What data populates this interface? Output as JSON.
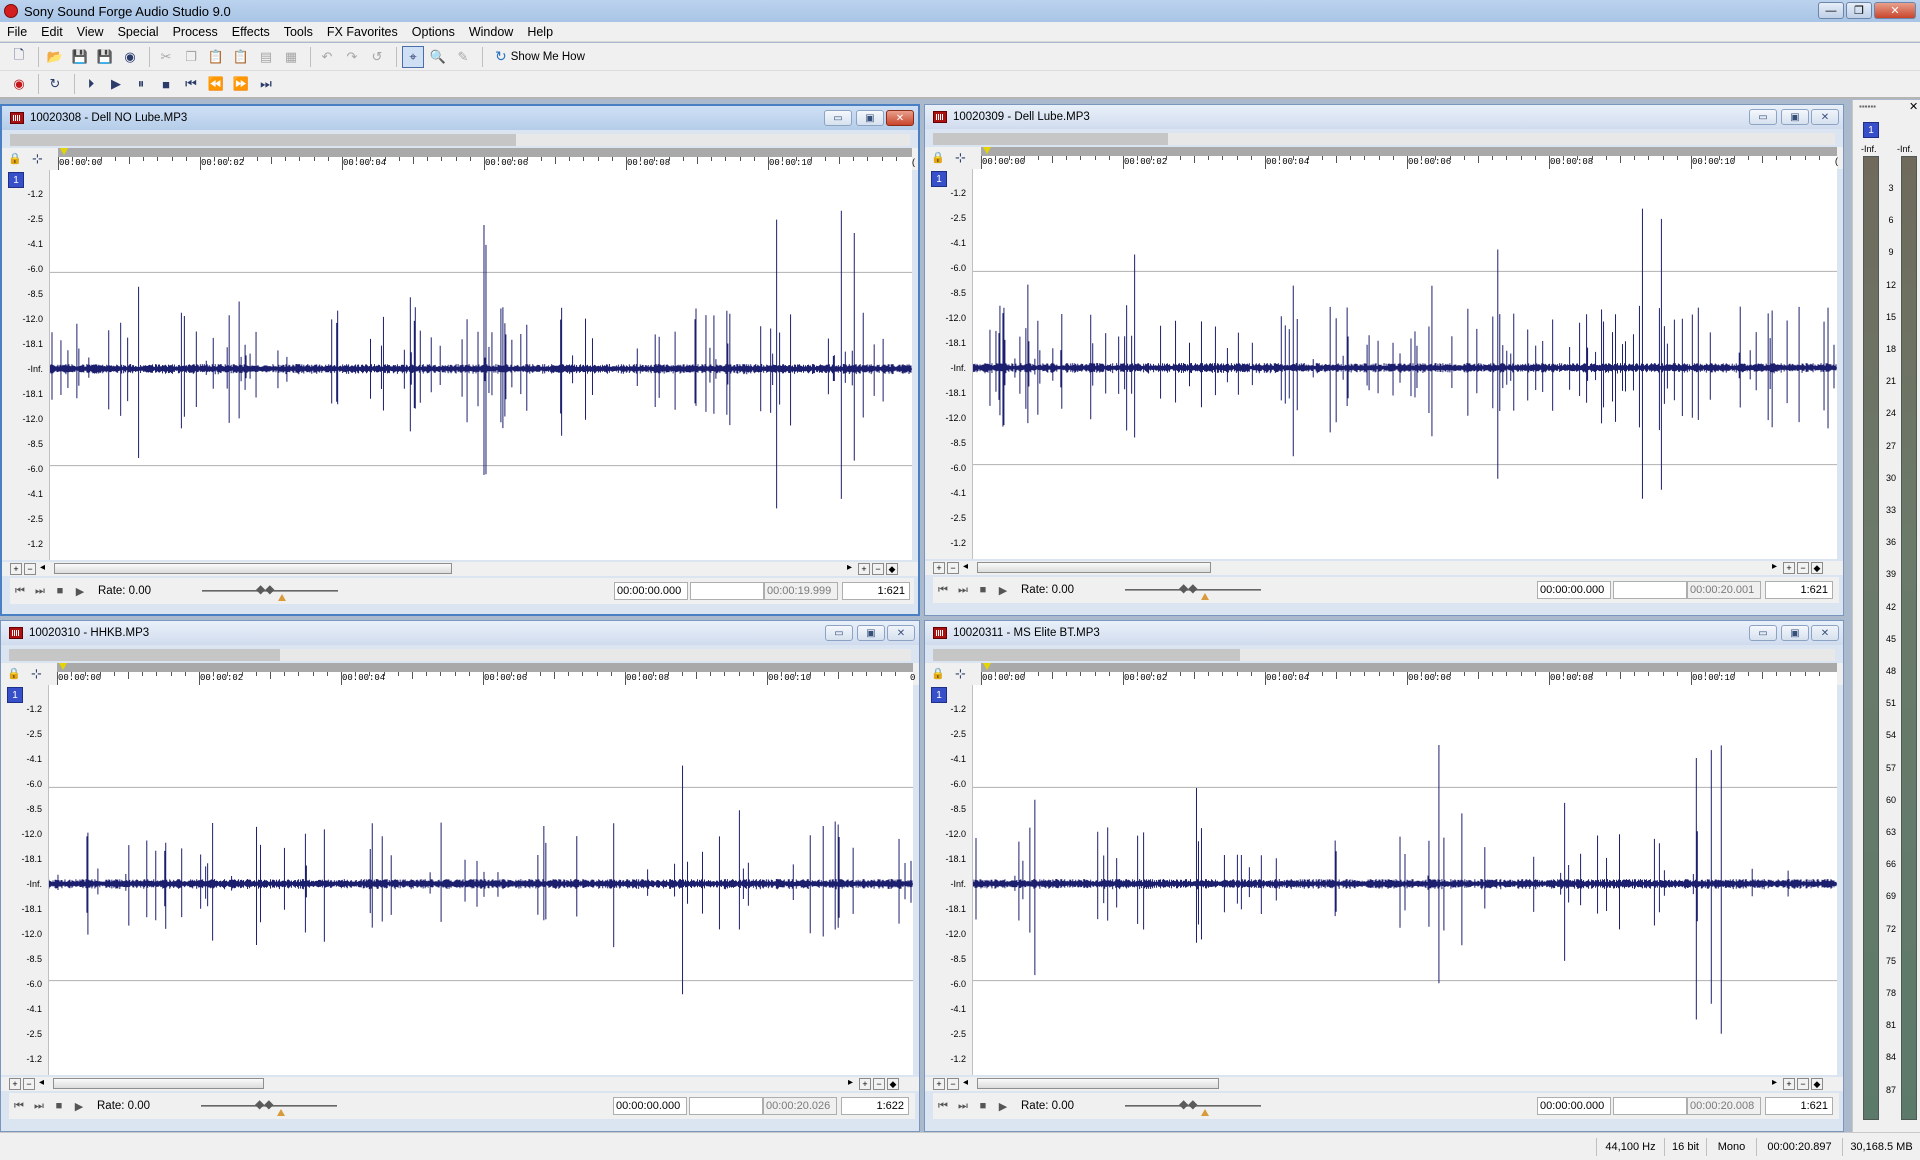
{
  "app": {
    "title": "Sony Sound Forge Audio Studio 9.0",
    "window_controls": [
      "—",
      "❐",
      "✕"
    ]
  },
  "menu": [
    "File",
    "Edit",
    "View",
    "Special",
    "Process",
    "Effects",
    "Tools",
    "FX Favorites",
    "Options",
    "Window",
    "Help"
  ],
  "toolbar": {
    "show_me_how": "Show Me How"
  },
  "ruler_labels": [
    "00:00:00",
    "00:00:02",
    "00:00:04",
    "00:00:06",
    "00:00:08",
    "00:00:10"
  ],
  "db_labels": [
    "-1.2",
    "-2.5",
    "-4.1",
    "-6.0",
    "-8.5",
    "-12.0",
    "-18.1",
    "-Inf.",
    "-18.1",
    "-12.0",
    "-8.5",
    "-6.0",
    "-4.1",
    "-2.5",
    "-1.2"
  ],
  "windows": [
    {
      "title": "10020308 - Dell NO Lube.MP3",
      "channel": "1",
      "rate_label": "Rate: 0.00",
      "selection_start": "00:00:00.000",
      "selection_length": "",
      "length": "00:00:19.999",
      "zoom": "1:621",
      "active": true,
      "overview_fraction": 0.56,
      "scroll_fraction": 0.51,
      "ruler_cutoff": "("
    },
    {
      "title": "10020309 - Dell Lube.MP3",
      "channel": "1",
      "rate_label": "Rate: 0.00",
      "selection_start": "00:00:00.000",
      "selection_length": "",
      "length": "00:00:20.001",
      "zoom": "1:621",
      "active": false,
      "overview_fraction": 0.26,
      "scroll_fraction": 0.3,
      "ruler_cutoff": "("
    },
    {
      "title": "10020310 - HHKB.MP3",
      "channel": "1",
      "rate_label": "Rate: 0.00",
      "selection_start": "00:00:00.000",
      "selection_length": "",
      "length": "00:00:20.026",
      "zoom": "1:622",
      "active": false,
      "overview_fraction": 0.3,
      "scroll_fraction": 0.27,
      "ruler_cutoff": "0"
    },
    {
      "title": "10020311 - MS Elite BT.MP3",
      "channel": "1",
      "rate_label": "Rate: 0.00",
      "selection_start": "00:00:00.000",
      "selection_length": "",
      "length": "00:00:20.008",
      "zoom": "1:621",
      "active": false,
      "overview_fraction": 0.34,
      "scroll_fraction": 0.31,
      "ruler_cutoff": ""
    }
  ],
  "meter": {
    "channel": "1",
    "inf_left": "-Inf.",
    "inf_right": "-Inf.",
    "scale": [
      "3",
      "6",
      "9",
      "12",
      "15",
      "18",
      "21",
      "24",
      "27",
      "30",
      "33",
      "36",
      "39",
      "42",
      "45",
      "48",
      "51",
      "54",
      "57",
      "60",
      "63",
      "66",
      "69",
      "72",
      "75",
      "78",
      "81",
      "84",
      "87"
    ]
  },
  "status": {
    "sample_rate": "44,100 Hz",
    "bit_depth": "16 bit",
    "channels": "Mono",
    "length": "00:00:20.897",
    "disk": "30,168.5 MB"
  },
  "colors": {
    "waveform": "#1c1f6e",
    "grid": "#b0b0b0",
    "channel_badge": "#3750c9"
  }
}
